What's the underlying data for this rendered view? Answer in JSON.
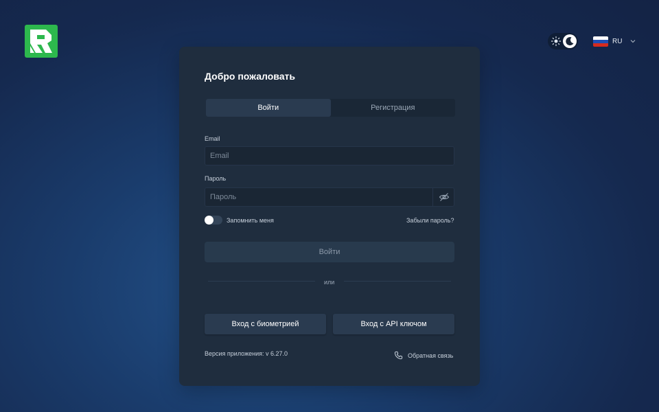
{
  "header": {
    "logo_icon": "brand-logo-icon",
    "theme": {
      "light_icon": "sun-icon",
      "dark_icon": "moon-icon",
      "active": "dark"
    },
    "language": {
      "code": "RU",
      "flag_icon": "russia-flag-icon",
      "flag_colors": [
        "#ffffff",
        "#1f4fb5",
        "#d52b1e"
      ]
    }
  },
  "card": {
    "title": "Добро пожаловать",
    "tabs": [
      {
        "label": "Войти",
        "active": true
      },
      {
        "label": "Регистрация",
        "active": false
      }
    ],
    "email": {
      "label": "Email",
      "placeholder": "Email",
      "value": ""
    },
    "password": {
      "label": "Пароль",
      "placeholder": "Пароль",
      "value": "",
      "toggle_icon": "eye-off-icon"
    },
    "remember_label": "Запомнить меня",
    "remember_checked": false,
    "forgot_link": "Забыли пароль?",
    "login_button": "Войти",
    "divider_text": "или",
    "biometric_button": "Вход с биометрией",
    "api_key_button": "Вход с API ключом",
    "version": "Версия приложения: v 6.27.0",
    "feedback_link": "Обратная связь",
    "feedback_icon": "phone-icon"
  },
  "colors": {
    "brand": "#2db84d",
    "card_bg": "#1f2d3e"
  }
}
